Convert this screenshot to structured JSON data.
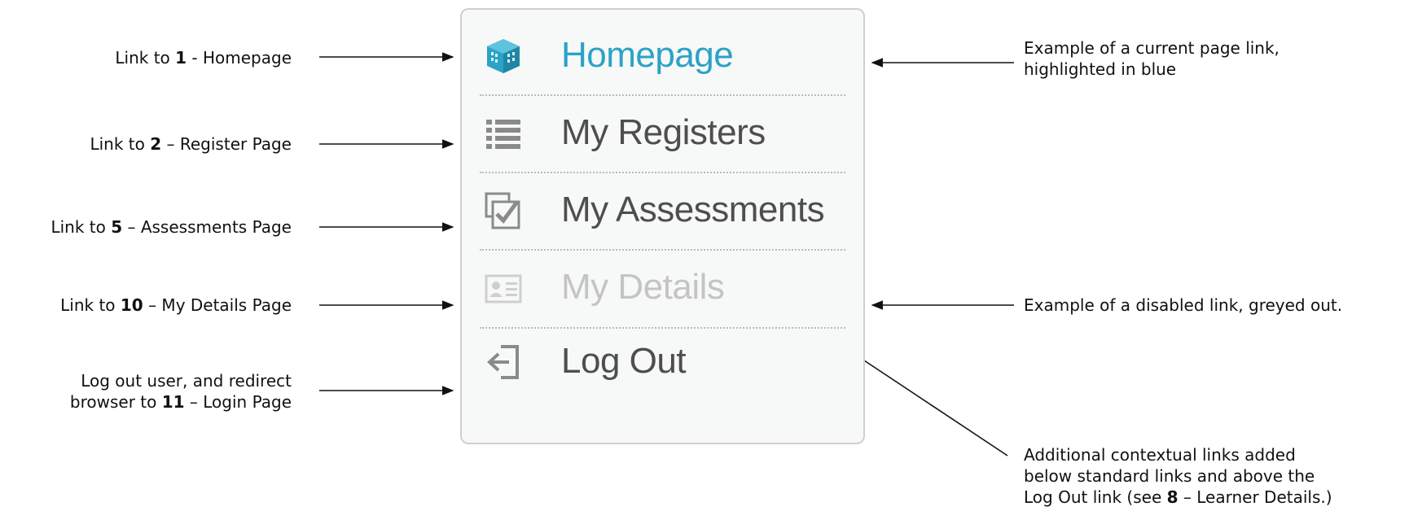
{
  "menu": {
    "items": [
      {
        "id": "homepage",
        "label": "Homepage",
        "icon": "homepage-building-icon",
        "state": "current"
      },
      {
        "id": "registers",
        "label": "My Registers",
        "icon": "list-icon",
        "state": "normal"
      },
      {
        "id": "assessments",
        "label": "My Assessments",
        "icon": "checkbox-icon",
        "state": "normal"
      },
      {
        "id": "details",
        "label": "My Details",
        "icon": "id-card-icon",
        "state": "disabled"
      },
      {
        "id": "logout",
        "label": "Log Out",
        "icon": "logout-icon",
        "state": "normal"
      }
    ]
  },
  "annotations_left": [
    {
      "pre": "Link to ",
      "num": "1",
      "post": " - Homepage"
    },
    {
      "pre": "Link to ",
      "num": "2",
      "post": " – Register Page"
    },
    {
      "pre": "Link to ",
      "num": "5",
      "post": " – Assessments Page"
    },
    {
      "pre": "Link to ",
      "num": "10",
      "post": " – My Details Page"
    },
    {
      "line1": "Log out user, and redirect",
      "pre": "browser to ",
      "num": "11",
      "post": " – Login Page"
    }
  ],
  "annotations_right": {
    "current": {
      "line1": "Example of a current page link,",
      "line2": "highlighted in blue"
    },
    "disabled": {
      "text": "Example of a disabled link, greyed out."
    },
    "contextual": {
      "line1": "Additional contextual links  added",
      "line2": "below standard links and above the",
      "pre": "Log Out link (see ",
      "num": "8",
      "post": " – Learner Details.)"
    }
  },
  "colors": {
    "current": "#2aa3c6",
    "normal": "#4e4e4e",
    "disabled": "#c4c4c4",
    "border": "#cfcfcf",
    "panel": "#f7f8f8"
  }
}
